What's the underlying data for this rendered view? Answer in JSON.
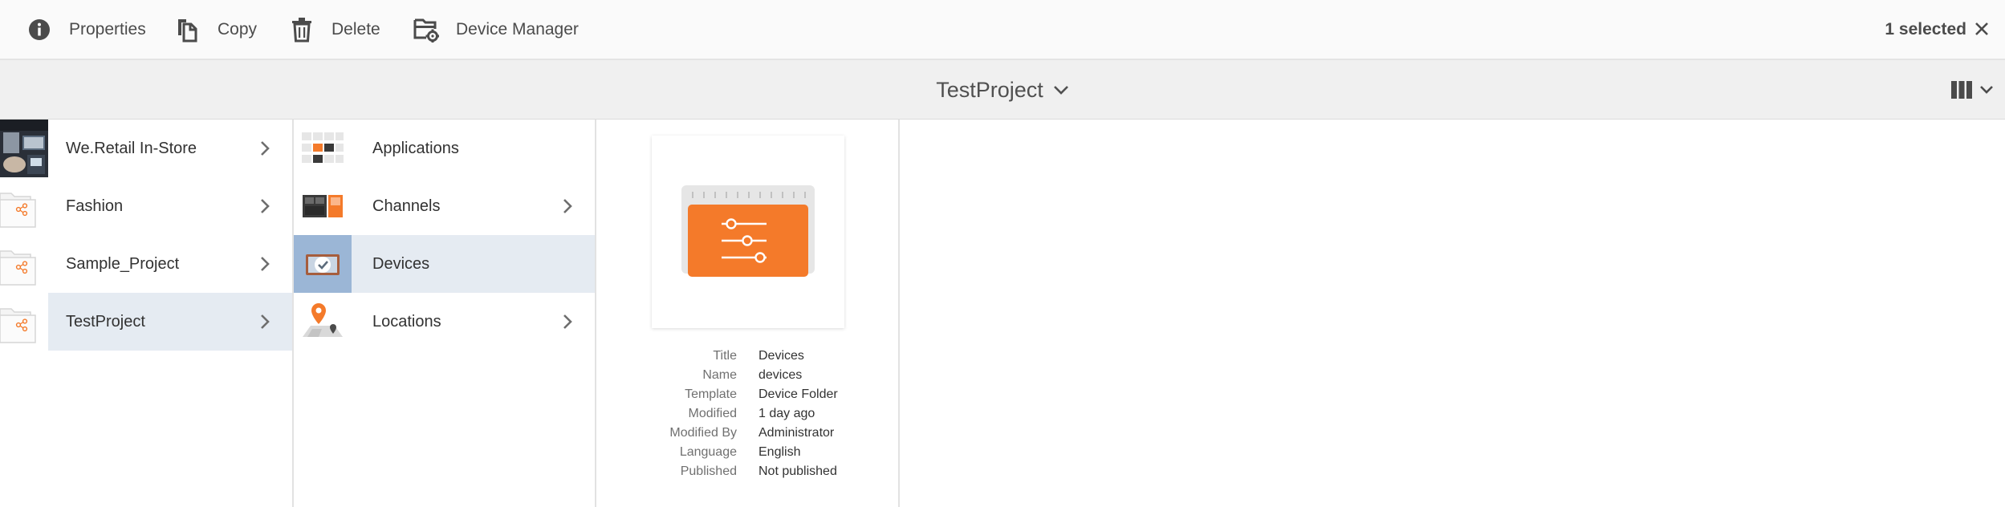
{
  "actionbar": {
    "properties_label": "Properties",
    "copy_label": "Copy",
    "delete_label": "Delete",
    "device_manager_label": "Device Manager",
    "selection_text": "1 selected"
  },
  "titlebar": {
    "title": "TestProject"
  },
  "columns": {
    "projects": [
      {
        "label": "We.Retail In-Store",
        "thumb": "photo-thumbnail",
        "has_children": true,
        "active": false
      },
      {
        "label": "Fashion",
        "thumb": "folder-share-icon",
        "has_children": true,
        "active": false
      },
      {
        "label": "Sample_Project",
        "thumb": "folder-share-icon",
        "has_children": true,
        "active": false
      },
      {
        "label": "TestProject",
        "thumb": "folder-share-icon",
        "has_children": true,
        "active": true
      }
    ],
    "folders": [
      {
        "label": "Applications",
        "thumb": "applications-icon",
        "has_children": false,
        "active": false
      },
      {
        "label": "Channels",
        "thumb": "channels-icon",
        "has_children": true,
        "active": false
      },
      {
        "label": "Devices",
        "thumb": "devices-icon",
        "has_children": false,
        "active": true
      },
      {
        "label": "Locations",
        "thumb": "locations-icon",
        "has_children": true,
        "active": false
      }
    ]
  },
  "preview": {
    "icon": "device-settings-sliders-icon",
    "meta": [
      {
        "key": "Title",
        "value": "Devices"
      },
      {
        "key": "Name",
        "value": "devices"
      },
      {
        "key": "Template",
        "value": "Device Folder"
      },
      {
        "key": "Modified",
        "value": "1 day ago"
      },
      {
        "key": "Modified By",
        "value": "Administrator"
      },
      {
        "key": "Language",
        "value": "English"
      },
      {
        "key": "Published",
        "value": "Not published"
      }
    ]
  },
  "colors": {
    "accent_orange": "#f47a2a",
    "selected_row": "#e5ebf2",
    "toolbar_bg": "#fafafa",
    "titlebar_bg": "#f0f0f0"
  }
}
